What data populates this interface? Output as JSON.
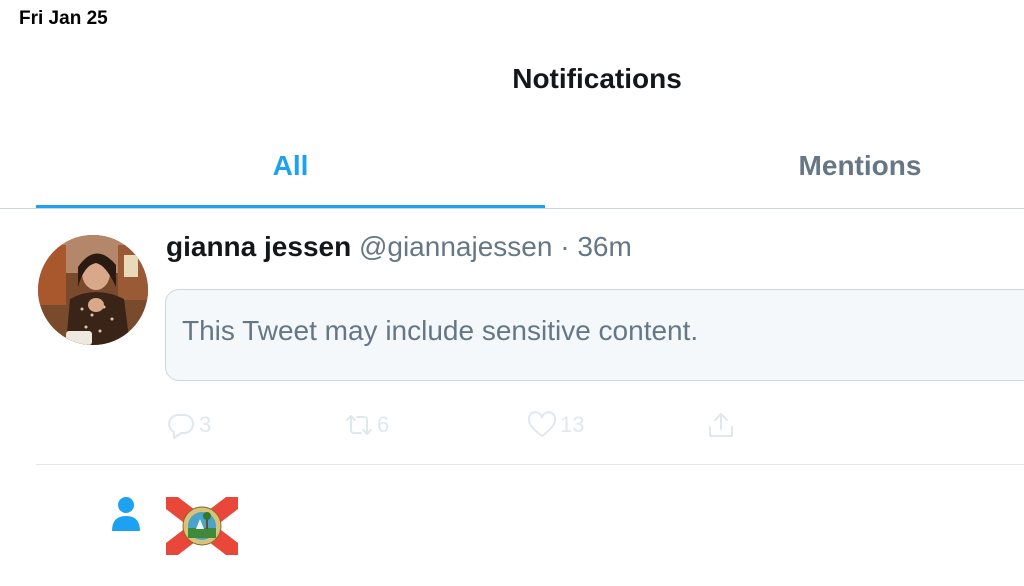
{
  "status_bar": {
    "date": "Fri Jan 25"
  },
  "nav": {
    "title": "Notifications"
  },
  "tabs": [
    {
      "label": "All",
      "active": true
    },
    {
      "label": "Mentions",
      "active": false
    }
  ],
  "tweet": {
    "name": "gianna jessen",
    "handle": "@giannajessen",
    "separator": "·",
    "time": "36m",
    "notice": "This Tweet may include sensitive content.",
    "actions": {
      "reply_count": "3",
      "retweet_count": "6",
      "like_count": "13"
    }
  },
  "follow_notification": {
    "icon": "person-icon",
    "avatar": "florida-flag-seal-avatar"
  },
  "colors": {
    "accent": "#1da1f2",
    "text_primary": "#14171a",
    "text_secondary": "#657786",
    "border": "#ccd6dd",
    "action_icons": "#e1e8ed"
  }
}
